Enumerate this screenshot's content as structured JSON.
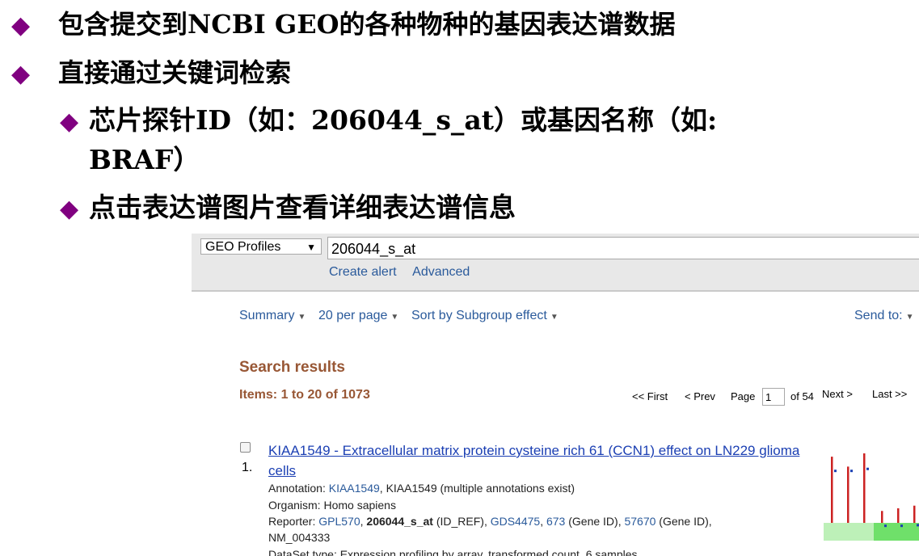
{
  "slide": {
    "bullet_marker": "◆",
    "b1": "包含提交到NCBI GEO的各种物种的基因表达谱数据",
    "b2": "直接通过关键词检索",
    "b3_line1": "芯片探针ID（如：206044_s_at）或基因名称（如:",
    "b3_line2": "BRAF）",
    "b4": "点击表达谱图片查看详细表达谱信息"
  },
  "search": {
    "database": "GEO Profiles",
    "term": "206044_s_at",
    "create_alert": "Create alert",
    "advanced": "Advanced"
  },
  "toolbar": {
    "summary": "Summary",
    "per_page": "20 per page",
    "sort": "Sort by Subgroup effect",
    "send_to": "Send to:"
  },
  "results": {
    "heading": "Search results",
    "items_label": "Items:",
    "items_range": "1 to 20 of 1073"
  },
  "pager": {
    "first": "<< First",
    "prev": "< Prev",
    "page_label": "Page",
    "page_value": "1",
    "of": "of 54",
    "next": "Next >",
    "last": "Last >>"
  },
  "result1": {
    "number": "1.",
    "title": "KIAA1549 - Extracellular matrix protein cysteine rich 61 (CCN1) effect on LN229 glioma cells",
    "annotation_label": "Annotation:",
    "annotation_link": "KIAA1549",
    "annotation_rest": ", KIAA1549 (multiple annotations exist)",
    "organism": "Organism: Homo sapiens",
    "reporter_label": "Reporter:",
    "reporter_gpl": "GPL570",
    "reporter_sep1": ", ",
    "reporter_probe": "206044_s_at",
    "reporter_idref": " (ID_REF), ",
    "reporter_gds": "GDS4475",
    "reporter_sep2": ", ",
    "reporter_gene": "673",
    "reporter_geneid1": " (Gene ID), ",
    "reporter_gene2": "57670",
    "reporter_geneid2": " (Gene ID),",
    "reporter_nm": "NM_004333",
    "dataset": "DataSet type: Expression profiling by array, transformed count, 6 samples"
  },
  "colors": {
    "diamond": "#800080",
    "results_heading": "#985735",
    "link": "#1b3fb3",
    "bar": "#cc2222",
    "group_a": "#bdf0b8",
    "group_b": "#6fe06a"
  },
  "sparkline": {
    "bars": [
      1.0,
      0.85,
      1.05,
      0.18,
      0.22,
      0.26
    ],
    "dots": [
      0.95,
      0.95,
      0.98,
      0.12,
      0.12,
      0.13
    ]
  }
}
